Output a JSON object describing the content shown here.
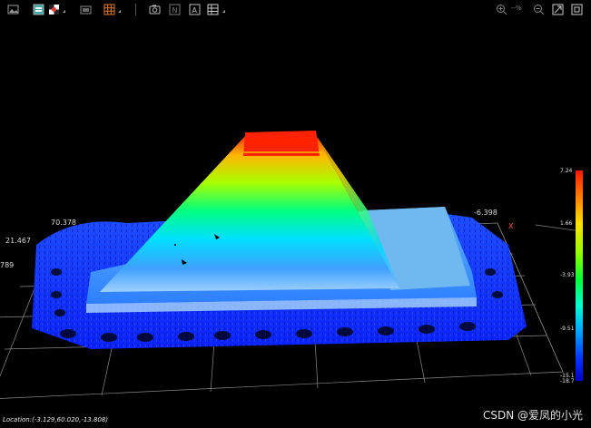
{
  "toolbar": {
    "zoom_readout": "--%"
  },
  "axes": {
    "x_axis_label": "X",
    "labels": [
      "70.378",
      "21.467",
      "789",
      "-6.398"
    ]
  },
  "colorbar": {
    "ticks": [
      "7.24",
      "1.66",
      "-3.93",
      "-9.51",
      "-15.1",
      "-18.7"
    ]
  },
  "status": {
    "location": "Location:(-3.129,60.020,-13.808)"
  },
  "watermark": "CSDN @爱凤的小光",
  "colors": {
    "background": "#000000",
    "accent": "#ff3300"
  }
}
